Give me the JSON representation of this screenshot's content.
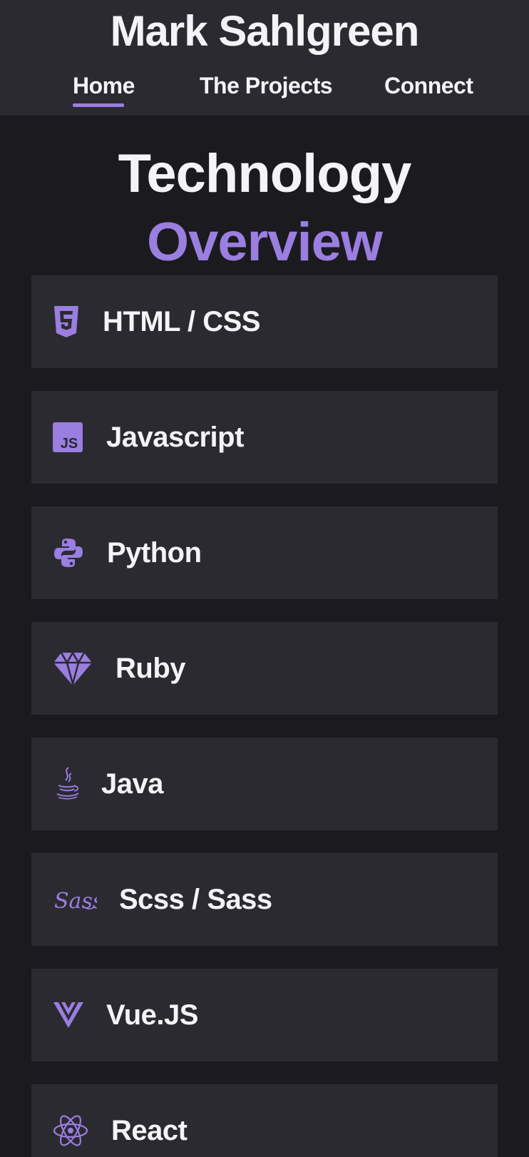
{
  "header": {
    "title": "Mark Sahlgreen",
    "nav": [
      {
        "label": "Home",
        "active": true
      },
      {
        "label": "The Projects",
        "active": false
      },
      {
        "label": "Connect",
        "active": false
      }
    ]
  },
  "main": {
    "heading_part1": "Technology",
    "heading_part2": "Overview",
    "technologies": [
      {
        "label": "HTML / CSS",
        "icon": "html5-icon"
      },
      {
        "label": "Javascript",
        "icon": "javascript-icon"
      },
      {
        "label": "Python",
        "icon": "python-icon"
      },
      {
        "label": "Ruby",
        "icon": "ruby-gem-icon"
      },
      {
        "label": "Java",
        "icon": "java-coffee-icon"
      },
      {
        "label": "Scss / Sass",
        "icon": "sass-icon"
      },
      {
        "label": "Vue.JS",
        "icon": "vue-icon"
      },
      {
        "label": "React",
        "icon": "react-atom-icon"
      }
    ]
  },
  "colors": {
    "accent": "#9a7ee0",
    "background": "#1b1a1f",
    "surface": "#2b2a31",
    "text": "#f4f4f6"
  }
}
